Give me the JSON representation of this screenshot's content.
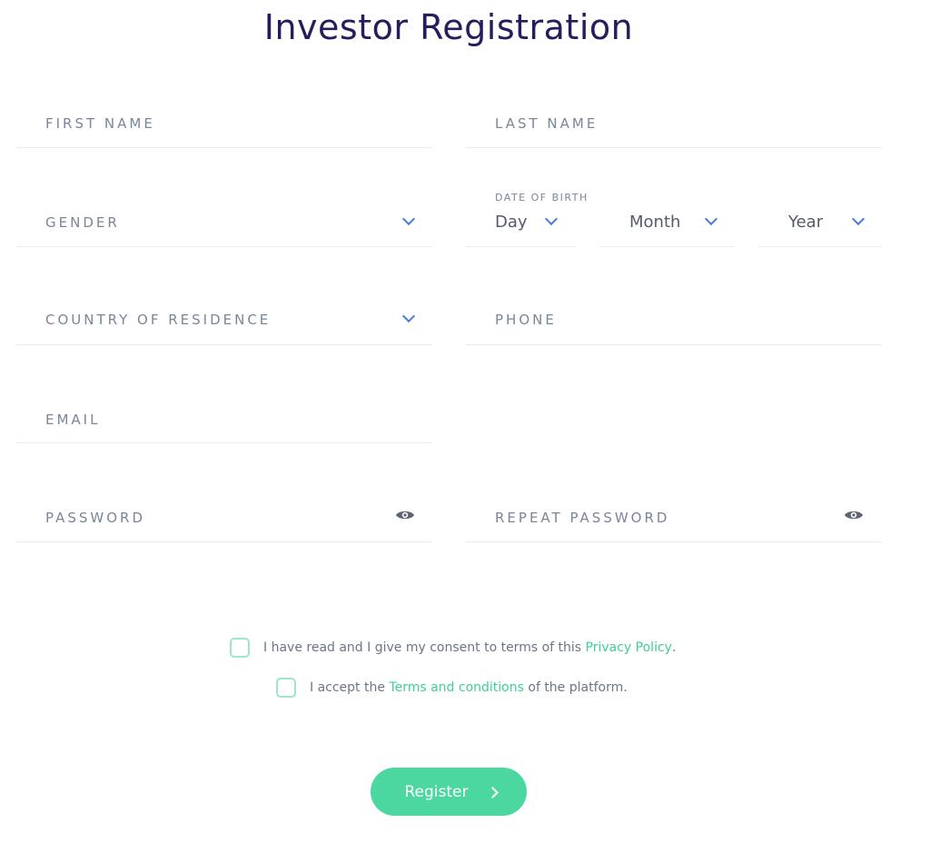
{
  "page": {
    "title": "Investor Registration"
  },
  "form": {
    "first_name": "FIRST NAME",
    "last_name": "LAST NAME",
    "gender": "GENDER",
    "date_of_birth": {
      "label": "DATE OF BIRTH",
      "day": "Day",
      "month": "Month",
      "year": "Year"
    },
    "country": "COUNTRY OF RESIDENCE",
    "phone": "PHONE",
    "email": "EMAIL",
    "password": "PASSWORD",
    "repeat_password": "REPEAT PASSWORD"
  },
  "consent": {
    "privacy_text": "I have read and I give my consent to terms of this ",
    "privacy_link": "Privacy Policy",
    "privacy_end": ".",
    "terms_text": "I accept the ",
    "terms_link": "Terms and conditions",
    "terms_end": " of the platform."
  },
  "actions": {
    "register": "Register"
  },
  "icons": {
    "dropdown": "chevron-down-icon",
    "show_password": "eye-icon",
    "submit_arrow": "chevron-right-icon"
  },
  "colors": {
    "title": "#241f5c",
    "label": "#7a8699",
    "chevron": "#4a7dd9",
    "accent": "#3fcf98",
    "button": "#4dd7a0",
    "checkbox_border": "#9fe6cb"
  }
}
